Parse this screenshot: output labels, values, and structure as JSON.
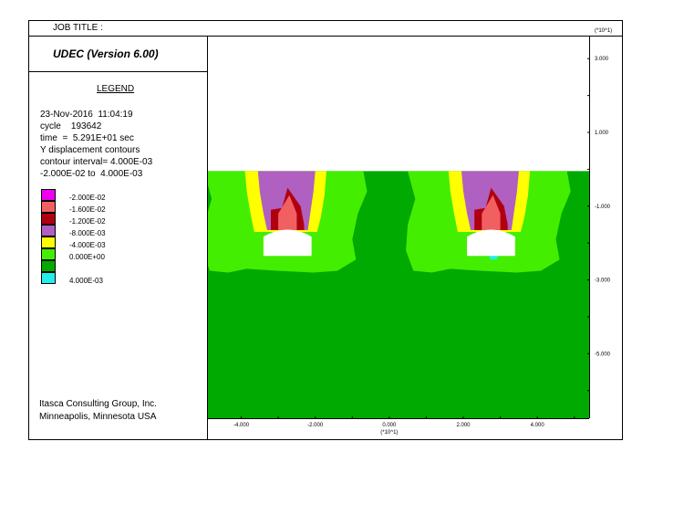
{
  "header": {
    "job_title": "JOB TITLE :",
    "program": "UDEC (Version 6.00)"
  },
  "legend": {
    "title": "LEGEND",
    "info": [
      "23-Nov-2016  11:04:19",
      "cycle    193642",
      "time  =  5.291E+01 sec",
      "Y displacement contours",
      "contour interval= 4.000E-03",
      "-2.000E-02 to  4.000E-03"
    ],
    "items": [
      {
        "label": "-2.000E-02",
        "color": "#ee00ee"
      },
      {
        "label": "-1.600E-02",
        "color": "#f06060"
      },
      {
        "label": "-1.200E-02",
        "color": "#b00010"
      },
      {
        "label": "-8.000E-03",
        "color": "#b060c0"
      },
      {
        "label": "-4.000E-03",
        "color": "#ffff00"
      },
      {
        "label": "0.000E+00",
        "color": "#44ee00"
      },
      {
        "label": "",
        "color": "#00aa00"
      },
      {
        "label": "4.000E-03",
        "color": "#22eeee"
      }
    ]
  },
  "footer": {
    "line1": "Itasca Consulting Group, Inc.",
    "line2": "Minneapolis, Minnesota  USA"
  },
  "chart_data": {
    "type": "heatmap",
    "title": "Y displacement contours",
    "contour_interval": 0.004,
    "range": [
      -0.02,
      0.004
    ],
    "axis_multiplier_label": "(*10^1)",
    "x_ticks": [
      "-4.000",
      "-2.000",
      "0.000",
      "2.000",
      "4.000"
    ],
    "x_tick_values": [
      -4,
      -2,
      0,
      2,
      4
    ],
    "y_ticks": [
      "3.000",
      "1.000",
      "-1.000",
      "-3.000",
      "-5.000"
    ],
    "y_tick_values": [
      3,
      1,
      -1,
      -3,
      -5
    ],
    "xlim": [
      -4.9,
      5.4
    ],
    "ylim": [
      -6.75,
      3.6
    ],
    "ground_surface_y": -0.05,
    "openings": [
      {
        "x_center": -2.75,
        "y_top": -1.6,
        "y_bottom": -2.35,
        "half_width": 0.65
      },
      {
        "x_center": 2.75,
        "y_top": -1.6,
        "y_bottom": -2.35,
        "half_width": 0.65
      }
    ],
    "colors": {
      "background": "#00aa00",
      "zero": "#44ee00",
      "m004": "#ffff00",
      "m008": "#b060c0",
      "m012": "#b00010",
      "m016": "#f06060",
      "m020": "#ee00ee",
      "p004": "#22eeee"
    }
  }
}
